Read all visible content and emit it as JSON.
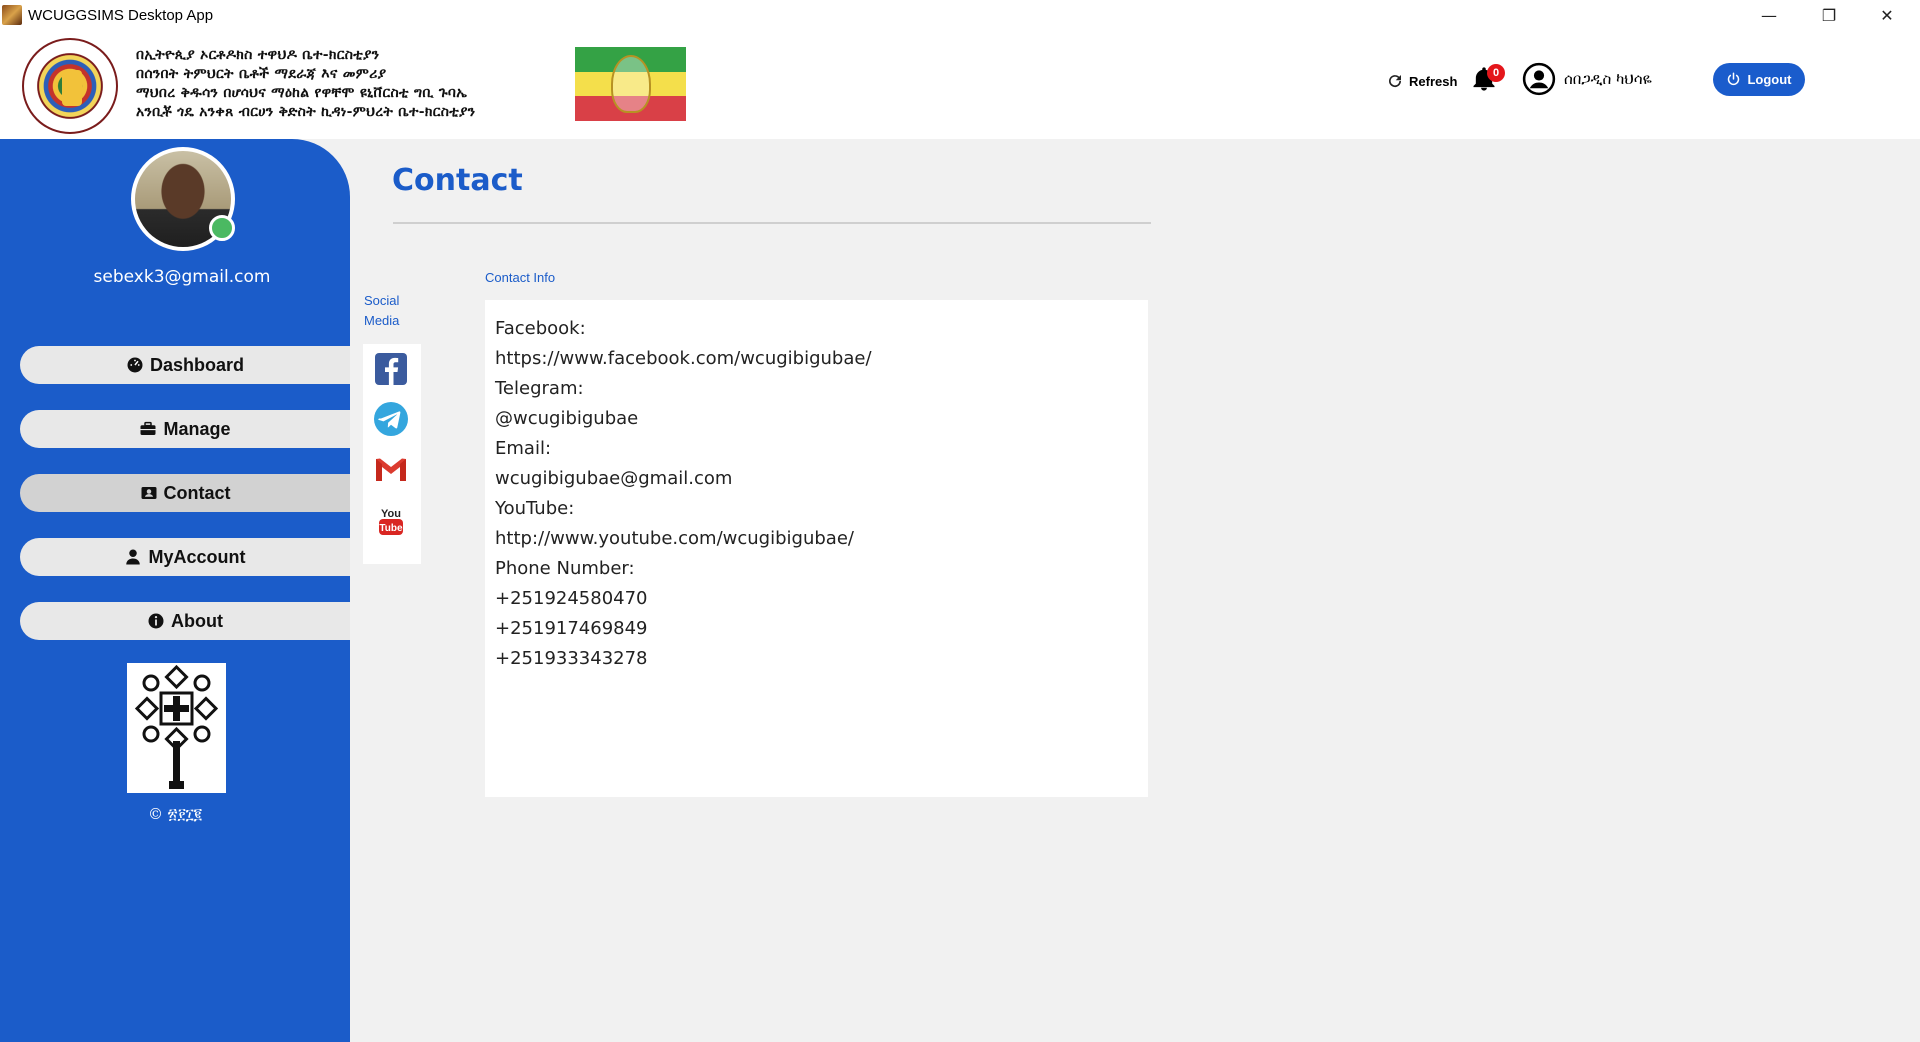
{
  "window": {
    "title": "WCUGGSIMS Desktop App",
    "minimize": "—",
    "restore": "❐",
    "close": "✕"
  },
  "header": {
    "org_lines": [
      "በኢትዮጲያ ኦርቶዶክስ ተዋህዶ ቤተ-ክርስቲያን",
      "በሰንበት ትምህርት ቤቶች ማደራጃ እና መምሪያ",
      "ማህበረ ቅዱሳን በሆሳህና ማዕከል የዋቸሞ ዩኒቨርስቲ ግቢ ጉባኤ",
      "አንቢቾ ጎዴ አንቀጸ ብርሀን ቅድስት ኪዳነ-ምህረት ቤተ-ክርስቲያን"
    ],
    "refresh_label": "Refresh",
    "notification_count": "0",
    "user_name": "ሰበጋዲስ ካህሳዬ",
    "logout_label": "Logout"
  },
  "sidebar": {
    "email": "sebexk3@gmail.com",
    "items": [
      {
        "label": "Dashboard",
        "icon": "dashboard-icon"
      },
      {
        "label": "Manage",
        "icon": "briefcase-icon"
      },
      {
        "label": "Contact",
        "icon": "contact-card-icon",
        "active": true
      },
      {
        "label": "MyAccount",
        "icon": "user-icon"
      },
      {
        "label": "About",
        "icon": "info-icon"
      }
    ],
    "copyright": "© ፳፻፲፪"
  },
  "main": {
    "title": "Contact",
    "social_label": "Social Media",
    "social_icons": [
      "facebook-icon",
      "telegram-icon",
      "gmail-icon",
      "youtube-icon"
    ],
    "contact_label": "Contact Info",
    "contact_lines": [
      "Facebook:",
      "https://www.facebook.com/wcugibigubae/",
      "Telegram:",
      "@wcugibigubae",
      "Email:",
      "wcugibigubae@gmail.com",
      "YouTube:",
      "http://www.youtube.com/wcugibigubae/",
      "Phone Number:",
      "+251924580470",
      "+251917469849",
      "+251933343278"
    ]
  },
  "colors": {
    "accent": "#1b5cc9",
    "background": "#f1f1f1",
    "online": "#4bb962",
    "badge": "#e4161b"
  }
}
